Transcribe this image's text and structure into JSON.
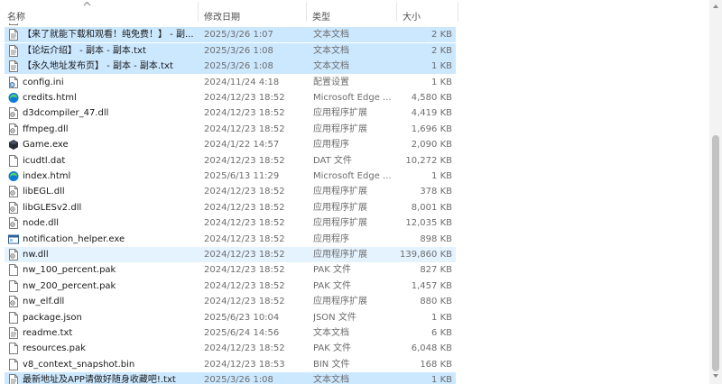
{
  "columns": {
    "name": "名称",
    "date": "修改日期",
    "type": "类型",
    "size": "大小"
  },
  "rows": [
    {
      "name": "",
      "date": "",
      "type": "",
      "size": "",
      "icon": "text-file-icon",
      "state": "partial-top"
    },
    {
      "name": "【来了就能下载和观看！纯免费！】 - 副...",
      "date": "2025/3/26 1:07",
      "type": "文本文档",
      "size": "2 KB",
      "icon": "text-file-icon",
      "state": "selected"
    },
    {
      "name": "【论坛介绍】 - 副本 - 副本.txt",
      "date": "2025/3/26 1:08",
      "type": "文本文档",
      "size": "2 KB",
      "icon": "text-file-icon",
      "state": "selected"
    },
    {
      "name": "【永久地址发布页】 - 副本 - 副本.txt",
      "date": "2025/3/26 1:08",
      "type": "文本文档",
      "size": "1 KB",
      "icon": "text-file-icon",
      "state": "selected"
    },
    {
      "name": "config.ini",
      "date": "2024/11/24 4:18",
      "type": "配置设置",
      "size": "1 KB",
      "icon": "settings-file-icon",
      "state": ""
    },
    {
      "name": "credits.html",
      "date": "2024/12/23 18:52",
      "type": "Microsoft Edge ...",
      "size": "4,580 KB",
      "icon": "edge-icon",
      "state": ""
    },
    {
      "name": "d3dcompiler_47.dll",
      "date": "2024/12/23 18:52",
      "type": "应用程序扩展",
      "size": "4,419 KB",
      "icon": "dll-file-icon",
      "state": ""
    },
    {
      "name": "ffmpeg.dll",
      "date": "2024/12/23 18:52",
      "type": "应用程序扩展",
      "size": "1,696 KB",
      "icon": "dll-file-icon",
      "state": ""
    },
    {
      "name": "Game.exe",
      "date": "2024/1/22 14:57",
      "type": "应用程序",
      "size": "2,090 KB",
      "icon": "game-exe-icon",
      "state": ""
    },
    {
      "name": "icudtl.dat",
      "date": "2024/12/23 18:52",
      "type": "DAT 文件",
      "size": "10,272 KB",
      "icon": "blank-file-icon",
      "state": ""
    },
    {
      "name": "index.html",
      "date": "2025/6/13 11:29",
      "type": "Microsoft Edge ...",
      "size": "1 KB",
      "icon": "edge-icon",
      "state": ""
    },
    {
      "name": "libEGL.dll",
      "date": "2024/12/23 18:52",
      "type": "应用程序扩展",
      "size": "378 KB",
      "icon": "dll-file-icon",
      "state": ""
    },
    {
      "name": "libGLESv2.dll",
      "date": "2024/12/23 18:52",
      "type": "应用程序扩展",
      "size": "8,001 KB",
      "icon": "dll-file-icon",
      "state": ""
    },
    {
      "name": "node.dll",
      "date": "2024/12/23 18:52",
      "type": "应用程序扩展",
      "size": "12,035 KB",
      "icon": "dll-file-icon",
      "state": ""
    },
    {
      "name": "notification_helper.exe",
      "date": "2024/12/23 18:52",
      "type": "应用程序",
      "size": "898 KB",
      "icon": "exe-window-icon",
      "state": ""
    },
    {
      "name": "nw.dll",
      "date": "2024/12/23 18:52",
      "type": "应用程序扩展",
      "size": "139,860 KB",
      "icon": "dll-file-icon",
      "state": "hover"
    },
    {
      "name": "nw_100_percent.pak",
      "date": "2024/12/23 18:52",
      "type": "PAK 文件",
      "size": "827 KB",
      "icon": "blank-file-icon",
      "state": ""
    },
    {
      "name": "nw_200_percent.pak",
      "date": "2024/12/23 18:52",
      "type": "PAK 文件",
      "size": "1,457 KB",
      "icon": "blank-file-icon",
      "state": ""
    },
    {
      "name": "nw_elf.dll",
      "date": "2024/12/23 18:52",
      "type": "应用程序扩展",
      "size": "880 KB",
      "icon": "dll-file-icon",
      "state": ""
    },
    {
      "name": "package.json",
      "date": "2025/6/23 10:04",
      "type": "JSON 文件",
      "size": "1 KB",
      "icon": "blank-file-icon",
      "state": ""
    },
    {
      "name": "readme.txt",
      "date": "2025/6/24 14:56",
      "type": "文本文档",
      "size": "6 KB",
      "icon": "text-file-icon",
      "state": ""
    },
    {
      "name": "resources.pak",
      "date": "2024/12/23 18:52",
      "type": "PAK 文件",
      "size": "6,048 KB",
      "icon": "blank-file-icon",
      "state": ""
    },
    {
      "name": "v8_context_snapshot.bin",
      "date": "2024/12/23 18:53",
      "type": "BIN 文件",
      "size": "168 KB",
      "icon": "blank-file-icon",
      "state": ""
    },
    {
      "name": "最新地址及APP请做好随身收藏吧!.txt",
      "date": "2025/3/26 1:08",
      "type": "文本文档",
      "size": "1 KB",
      "icon": "text-file-icon",
      "state": "selected"
    }
  ],
  "colors": {
    "selected": "#cce8ff",
    "hover": "#e5f3ff",
    "edge_accent": "#0c7bd6",
    "secondary_text": "#6d6d6d"
  }
}
